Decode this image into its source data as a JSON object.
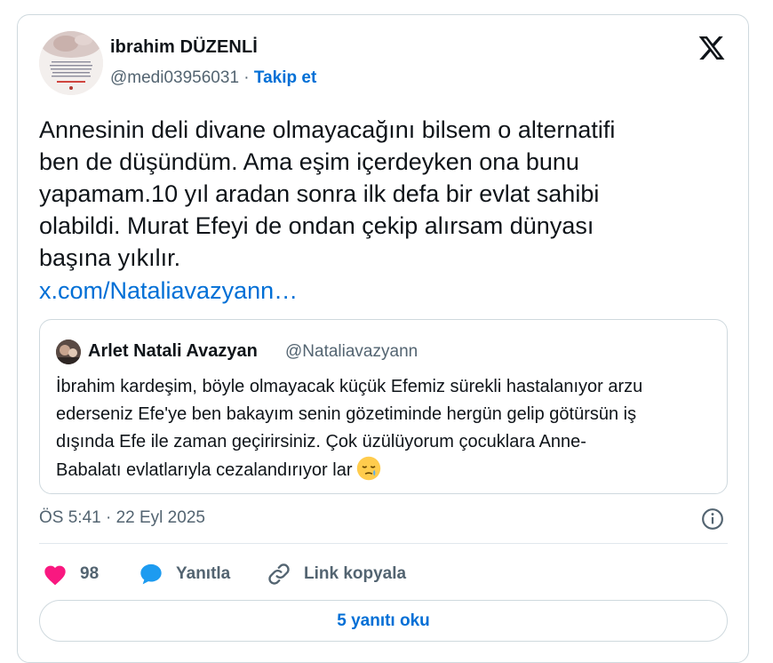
{
  "author": {
    "name": "ibrahim DÜZENLİ",
    "handle": "@medi03956031",
    "separator": "·",
    "follow_label": "Takip et"
  },
  "tweet": {
    "text": "Annesinin deli divane olmayacağını bilsem o alternatifi\nben de düşündüm. Ama eşim içerdeyken ona bunu\nyapamam.10 yıl aradan sonra ilk defa bir evlat sahibi\nolabildi. Murat Efeyi de ondan çekip alırsam dünyası\nbaşına yıkılır.",
    "link": "x.com/Nataliavazyann…"
  },
  "quote": {
    "name": "Arlet Natali Avazyan",
    "handle": "@Nataliavazyann",
    "text": "İbrahim kardeşim, böyle olmayacak küçük Efemiz sürekli hastalanıyor arzu\nederseniz Efe'ye ben bakayım senin gözetiminde hergün gelip götürsün iş\ndışında Efe ile zaman geçirirsiniz. Çok üzülüyorum çocuklara Anne-\nBabalatı evlatlarıyla cezalandırıyor lar",
    "emoji": "sleepy-face-emoji"
  },
  "timestamp": "ÖS 5:41 · 22 Eyl 2025",
  "actions": {
    "likes_count": "98",
    "reply_label": "Yanıtla",
    "copy_link_label": "Link kopyala"
  },
  "read_replies_label": "5 yanıtı oku",
  "icons": {
    "logo": "x-logo-icon",
    "like": "heart-icon",
    "reply": "speech-bubble-icon",
    "link": "link-icon",
    "info": "info-icon"
  },
  "colors": {
    "accent": "#006fd6",
    "like": "#f91880",
    "reply": "#1d9bf0",
    "text": "#0f1419",
    "muted": "#536471",
    "border": "#cfd9de"
  }
}
